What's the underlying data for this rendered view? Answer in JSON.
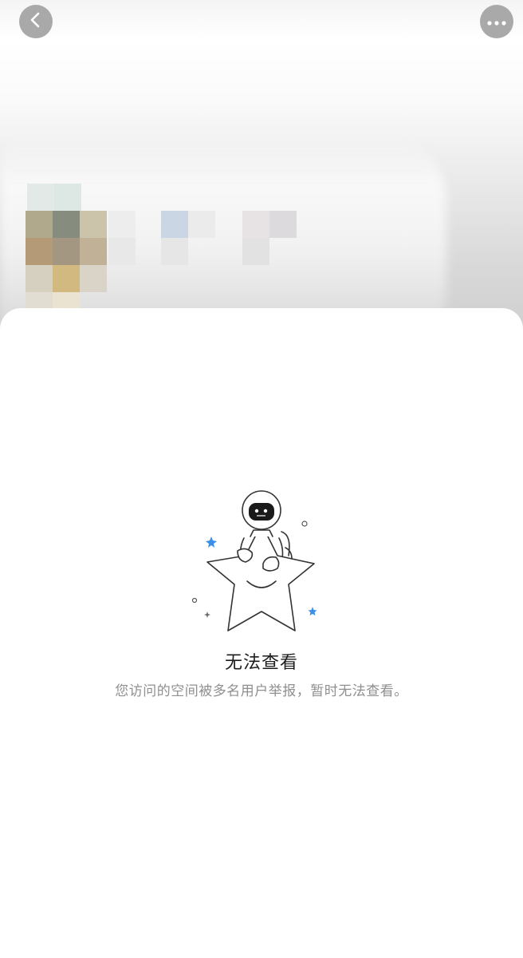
{
  "nav": {
    "back_icon": "chevron-left-icon",
    "more_icon": "ellipsis-icon"
  },
  "empty_state": {
    "title": "无法查看",
    "description": "您访问的空间被多名用户举报，暂时无法查看。",
    "illustration": "astronaut-on-star",
    "accent_color": "#3b8fe8"
  },
  "colors": {
    "button_bg": "#a9a9a9",
    "title": "#1c1c1c",
    "description": "#8f8f8f"
  }
}
